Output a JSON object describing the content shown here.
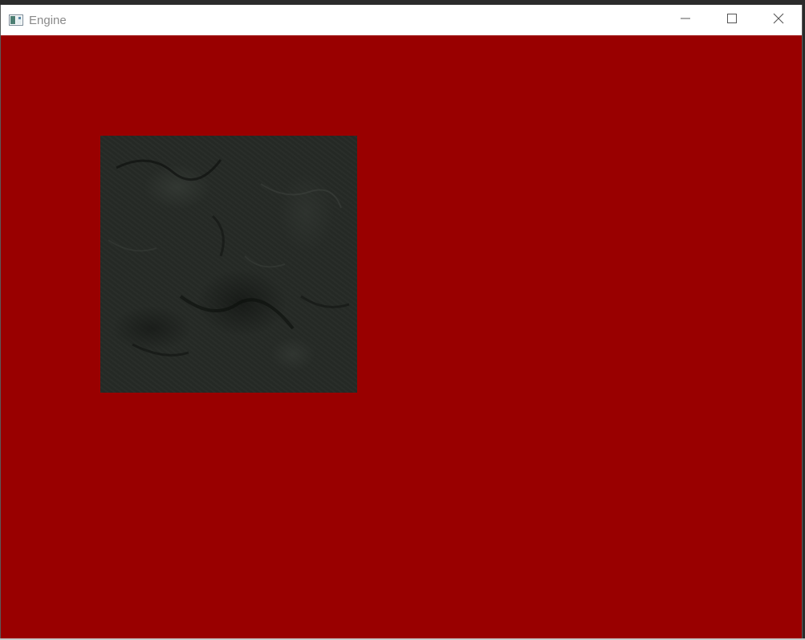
{
  "window": {
    "title": "Engine",
    "app_icon": "window-app-icon",
    "clear_color": "#990000"
  },
  "caption_buttons": {
    "minimize_icon": "minimize-icon",
    "maximize_icon": "maximize-icon",
    "close_icon": "close-icon"
  },
  "scene": {
    "quad_texture": "dark-stone-texture",
    "quad_base_color": "#262a26"
  }
}
